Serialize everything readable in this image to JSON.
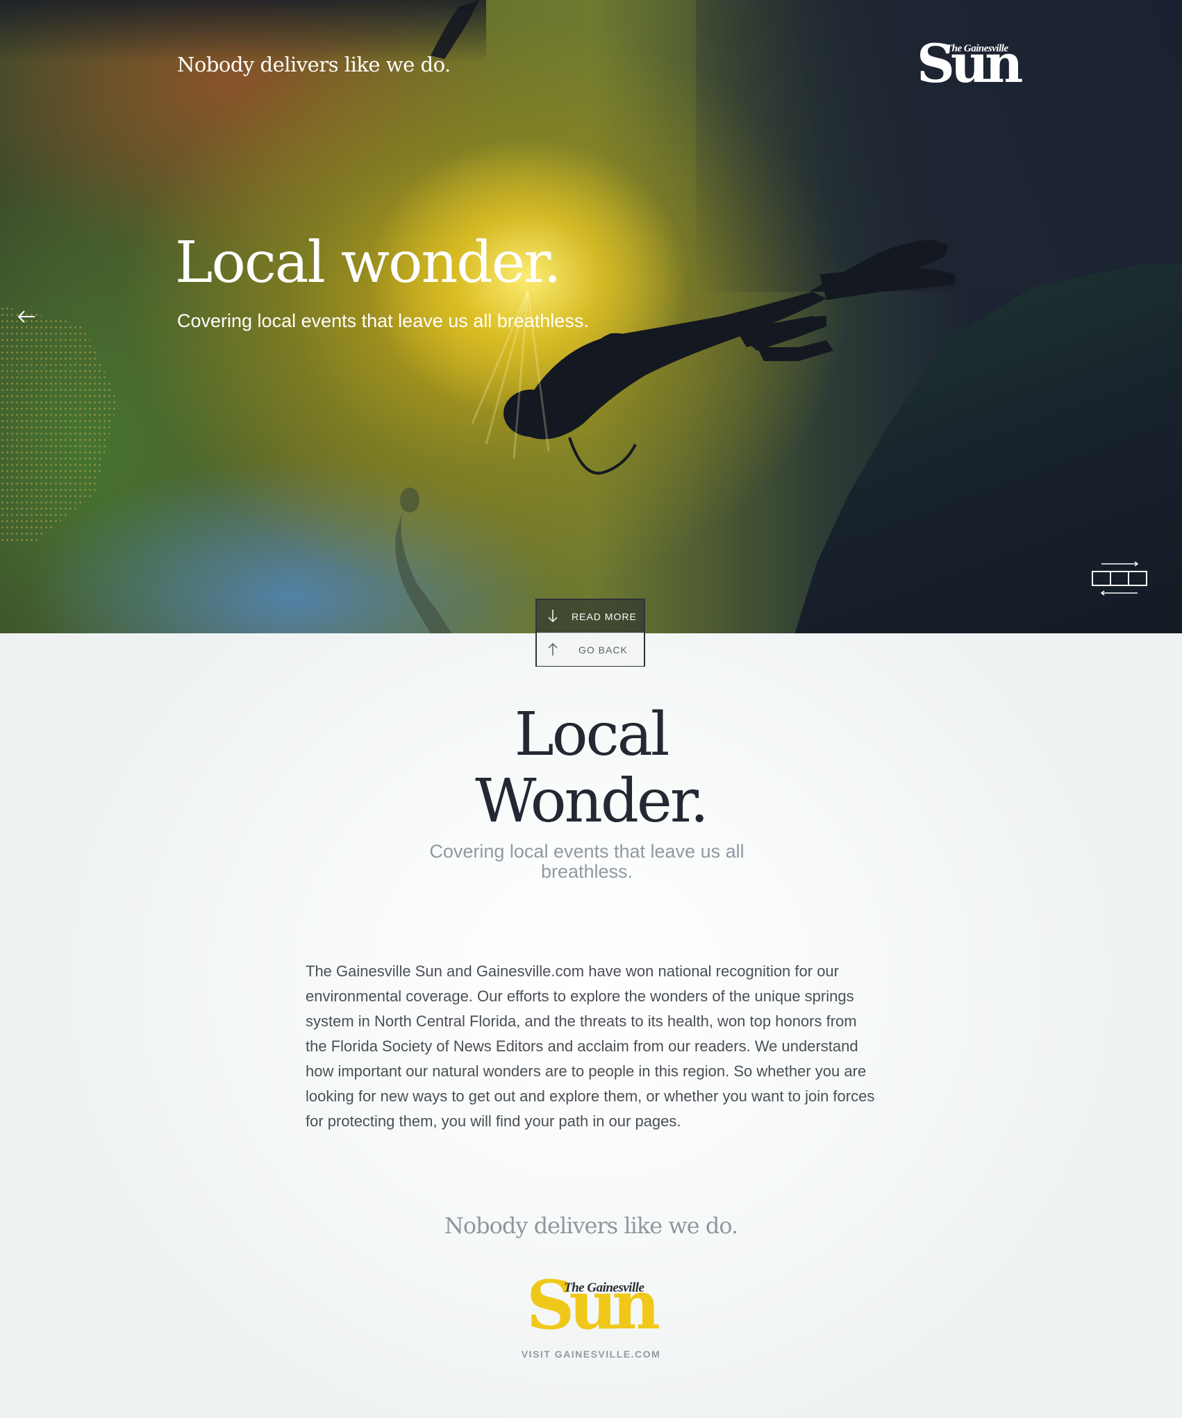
{
  "hero": {
    "tagline": "Nobody delivers like we do.",
    "title": "Local wonder.",
    "subtitle": "Covering local events that leave us all breathless.",
    "logo": {
      "the_gainesville": "The Gainesville",
      "sun": "Sun"
    }
  },
  "nav": {
    "read_more": "READ MORE",
    "go_back": "GO BACK"
  },
  "content": {
    "title_line1": "Local",
    "title_line2": "Wonder.",
    "subtitle": "Covering local events that leave us all breathless.",
    "body": "The Gainesville Sun and Gainesville.com have won national recognition for our environmental coverage. Our efforts to explore the wonders of the unique springs system in North Central Florida, and the threats to its health, won top honors from the Florida Society of News Editors and acclaim from our readers. We understand how important our natural wonders are to people in this region. So whether you are looking for new ways to get out and explore them, or whether you want to join forces for protecting them, you will find your path in our pages.",
    "tagline": "Nobody delivers like we do.",
    "logo": {
      "the_gainesville": "The Gainesville",
      "sun": "Sun"
    },
    "visit_link": "VISIT GAINESVILLE.COM"
  },
  "colors": {
    "brand_yellow": "#f0c819",
    "dark_text": "#232833",
    "muted_text": "#8e9aa2"
  }
}
